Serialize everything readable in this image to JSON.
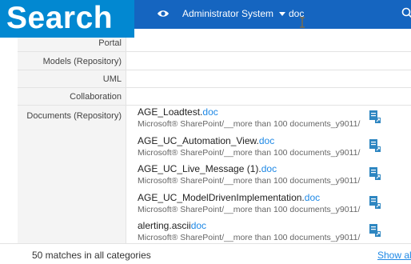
{
  "badge": {
    "text": "Search"
  },
  "toolbar": {
    "scope": "Administrator System",
    "query": "doc"
  },
  "categories": [
    {
      "label": "Portal"
    },
    {
      "label": "Models (Repository)"
    },
    {
      "label": "UML"
    },
    {
      "label": "Collaboration"
    },
    {
      "label": "Documents (Repository)"
    }
  ],
  "results": [
    {
      "name": "AGE_Loadtest.",
      "match": "doc",
      "path": "Microsoft® SharePoint/__more than 100 documents_y9011/"
    },
    {
      "name": "AGE_UC_Automation_View.",
      "match": "doc",
      "path": "Microsoft® SharePoint/__more than 100 documents_y9011/"
    },
    {
      "name": "AGE_UC_Live_Message (1).",
      "match": "doc",
      "path": "Microsoft® SharePoint/__more than 100 documents_y9011/"
    },
    {
      "name": "AGE_UC_ModelDrivenImplementation.",
      "match": "doc",
      "path": "Microsoft® SharePoint/__more than 100 documents_y9011/"
    },
    {
      "name": "alerting.ascii",
      "match": "doc",
      "path": "Microsoft® SharePoint/__more than 100 documents_y9011/"
    }
  ],
  "footer": {
    "count": "50 matches in all categories",
    "show_all": "Show all"
  },
  "colors": {
    "topbar": "#1565c0",
    "badge": "#0288d1",
    "highlight": "#1e88e5",
    "doc_icon": "#2e86c1"
  }
}
